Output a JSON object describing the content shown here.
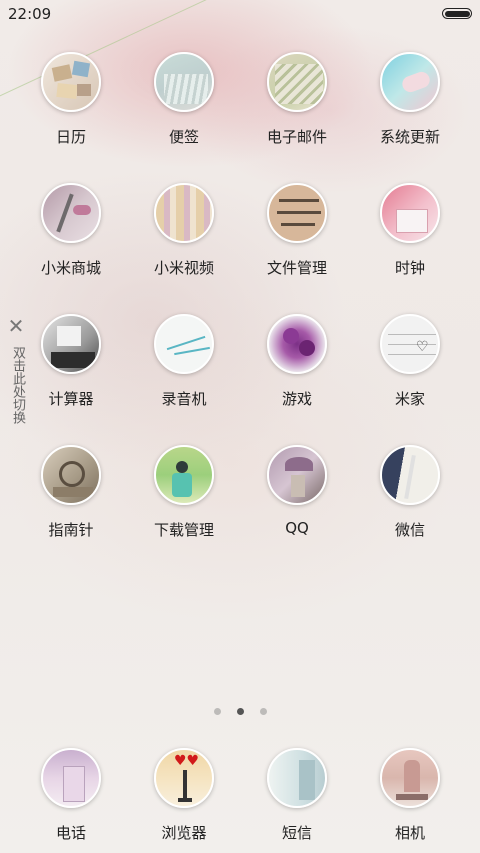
{
  "status_bar": {
    "time": "22:09"
  },
  "side_hint": {
    "close": "✕",
    "text": "双击此处切换"
  },
  "apps": [
    {
      "label": "日历",
      "icon": "calendar-icon"
    },
    {
      "label": "便签",
      "icon": "notes-icon"
    },
    {
      "label": "电子邮件",
      "icon": "email-icon"
    },
    {
      "label": "系统更新",
      "icon": "update-icon"
    },
    {
      "label": "小米商城",
      "icon": "mi-store-icon"
    },
    {
      "label": "小米视频",
      "icon": "mi-video-icon"
    },
    {
      "label": "文件管理",
      "icon": "file-manager-icon"
    },
    {
      "label": "时钟",
      "icon": "clock-icon"
    },
    {
      "label": "计算器",
      "icon": "calculator-icon"
    },
    {
      "label": "录音机",
      "icon": "recorder-icon"
    },
    {
      "label": "游戏",
      "icon": "game-icon"
    },
    {
      "label": "米家",
      "icon": "mijia-icon"
    },
    {
      "label": "指南针",
      "icon": "compass-icon"
    },
    {
      "label": "下载管理",
      "icon": "download-icon"
    },
    {
      "label": "QQ",
      "icon": "qq-icon"
    },
    {
      "label": "微信",
      "icon": "wechat-icon"
    }
  ],
  "pager": {
    "pages": 3,
    "active": 2
  },
  "dock": [
    {
      "label": "电话",
      "icon": "phone-icon"
    },
    {
      "label": "浏览器",
      "icon": "browser-icon"
    },
    {
      "label": "短信",
      "icon": "sms-icon"
    },
    {
      "label": "相机",
      "icon": "camera-icon"
    }
  ]
}
